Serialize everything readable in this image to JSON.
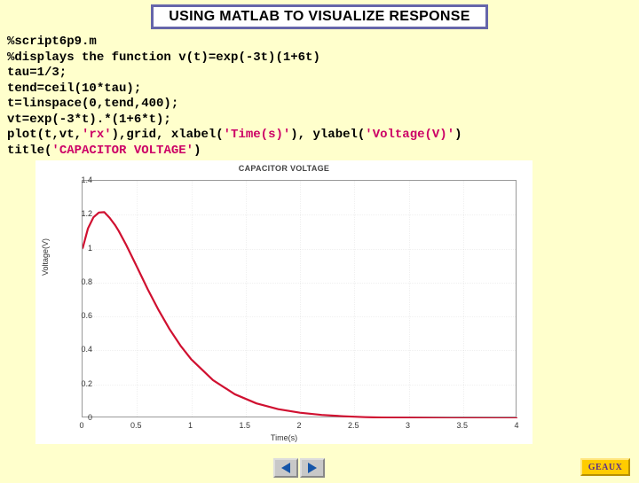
{
  "header": "USING MATLAB TO VISUALIZE RESPONSE",
  "code": {
    "l1": "%script6p9.m",
    "l2": "%displays the function v(t)=exp(-3t)(1+6t)",
    "l3": "tau=1/3;",
    "l4": "tend=ceil(10*tau);",
    "l5": "t=linspace(0,tend,400);",
    "l6": "vt=exp(-3*t).*(1+6*t);",
    "l7a": "plot(t,vt,",
    "l7b": "'rx'",
    "l7c": "),grid, xlabel(",
    "l7d": "'Time(s)'",
    "l7e": "), ylabel(",
    "l7f": "'Voltage(V)'",
    "l7g": ")",
    "l8a": "title(",
    "l8b": "'CAPACITOR VOLTAGE'",
    "l8c": ")"
  },
  "chart_data": {
    "type": "line",
    "title": "CAPACITOR VOLTAGE",
    "xlabel": "Time(s)",
    "ylabel": "Voltage(V)",
    "xlim": [
      0,
      4
    ],
    "ylim": [
      0,
      1.4
    ],
    "xticks": [
      0,
      0.5,
      1,
      1.5,
      2,
      2.5,
      3,
      3.5,
      4
    ],
    "yticks": [
      0,
      0.2,
      0.4,
      0.6,
      0.8,
      1,
      1.2,
      1.4
    ],
    "series": [
      {
        "name": "vt",
        "color": "#d01030",
        "x": [
          0,
          0.05,
          0.1,
          0.15,
          0.2,
          0.25,
          0.3,
          0.333,
          0.4,
          0.5,
          0.6,
          0.7,
          0.8,
          0.9,
          1.0,
          1.2,
          1.4,
          1.6,
          1.8,
          2.0,
          2.2,
          2.4,
          2.6,
          2.8,
          3.0,
          3.2,
          3.4,
          3.6,
          3.8,
          4.0
        ],
        "y": [
          1.0,
          1.119,
          1.185,
          1.213,
          1.215,
          1.181,
          1.138,
          1.104,
          1.024,
          0.893,
          0.76,
          0.637,
          0.526,
          0.429,
          0.348,
          0.225,
          0.142,
          0.088,
          0.054,
          0.033,
          0.02,
          0.012,
          0.007,
          0.004,
          0.003,
          0.002,
          0.001,
          0.001,
          0.0,
          0.0
        ]
      }
    ]
  },
  "nav": {
    "prev": "prev",
    "next": "next"
  },
  "brand": "GEAUX"
}
